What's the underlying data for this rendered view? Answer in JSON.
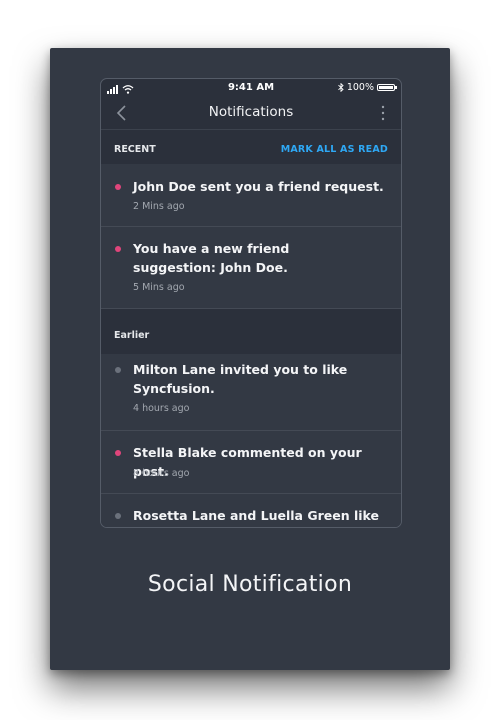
{
  "status_bar": {
    "time": "9:41 AM",
    "battery": "100%",
    "bluetooth_icon": "✱"
  },
  "header": {
    "title": "Notifications",
    "back_icon": "chevron-left-icon",
    "more_icon": "more-vertical-icon"
  },
  "sections": {
    "recent": {
      "label": "RECENT",
      "action": "MARK ALL AS READ"
    },
    "earlier": {
      "label": "Earlier"
    }
  },
  "notifications": [
    {
      "text": "John Doe sent you a friend request.",
      "time": "2 Mins ago",
      "unread": true
    },
    {
      "text": "You have a new friend suggestion: John Doe.",
      "time": "5 Mins ago",
      "unread": true
    },
    {
      "text": "Milton Lane invited you to like Syncfusion.",
      "time": "4 hours ago",
      "unread": false
    },
    {
      "text": "Stella Blake commented on your post.",
      "time": "8 hours ago",
      "unread": true
    },
    {
      "text": "Rosetta Lane and Luella Green like",
      "time": "",
      "unread": false
    }
  ],
  "caption": "Social Notification",
  "colors": {
    "unread_dot": "#e0457b",
    "read_dot": "#6b717c",
    "accent": "#2ea8f5",
    "background": "#333944"
  }
}
